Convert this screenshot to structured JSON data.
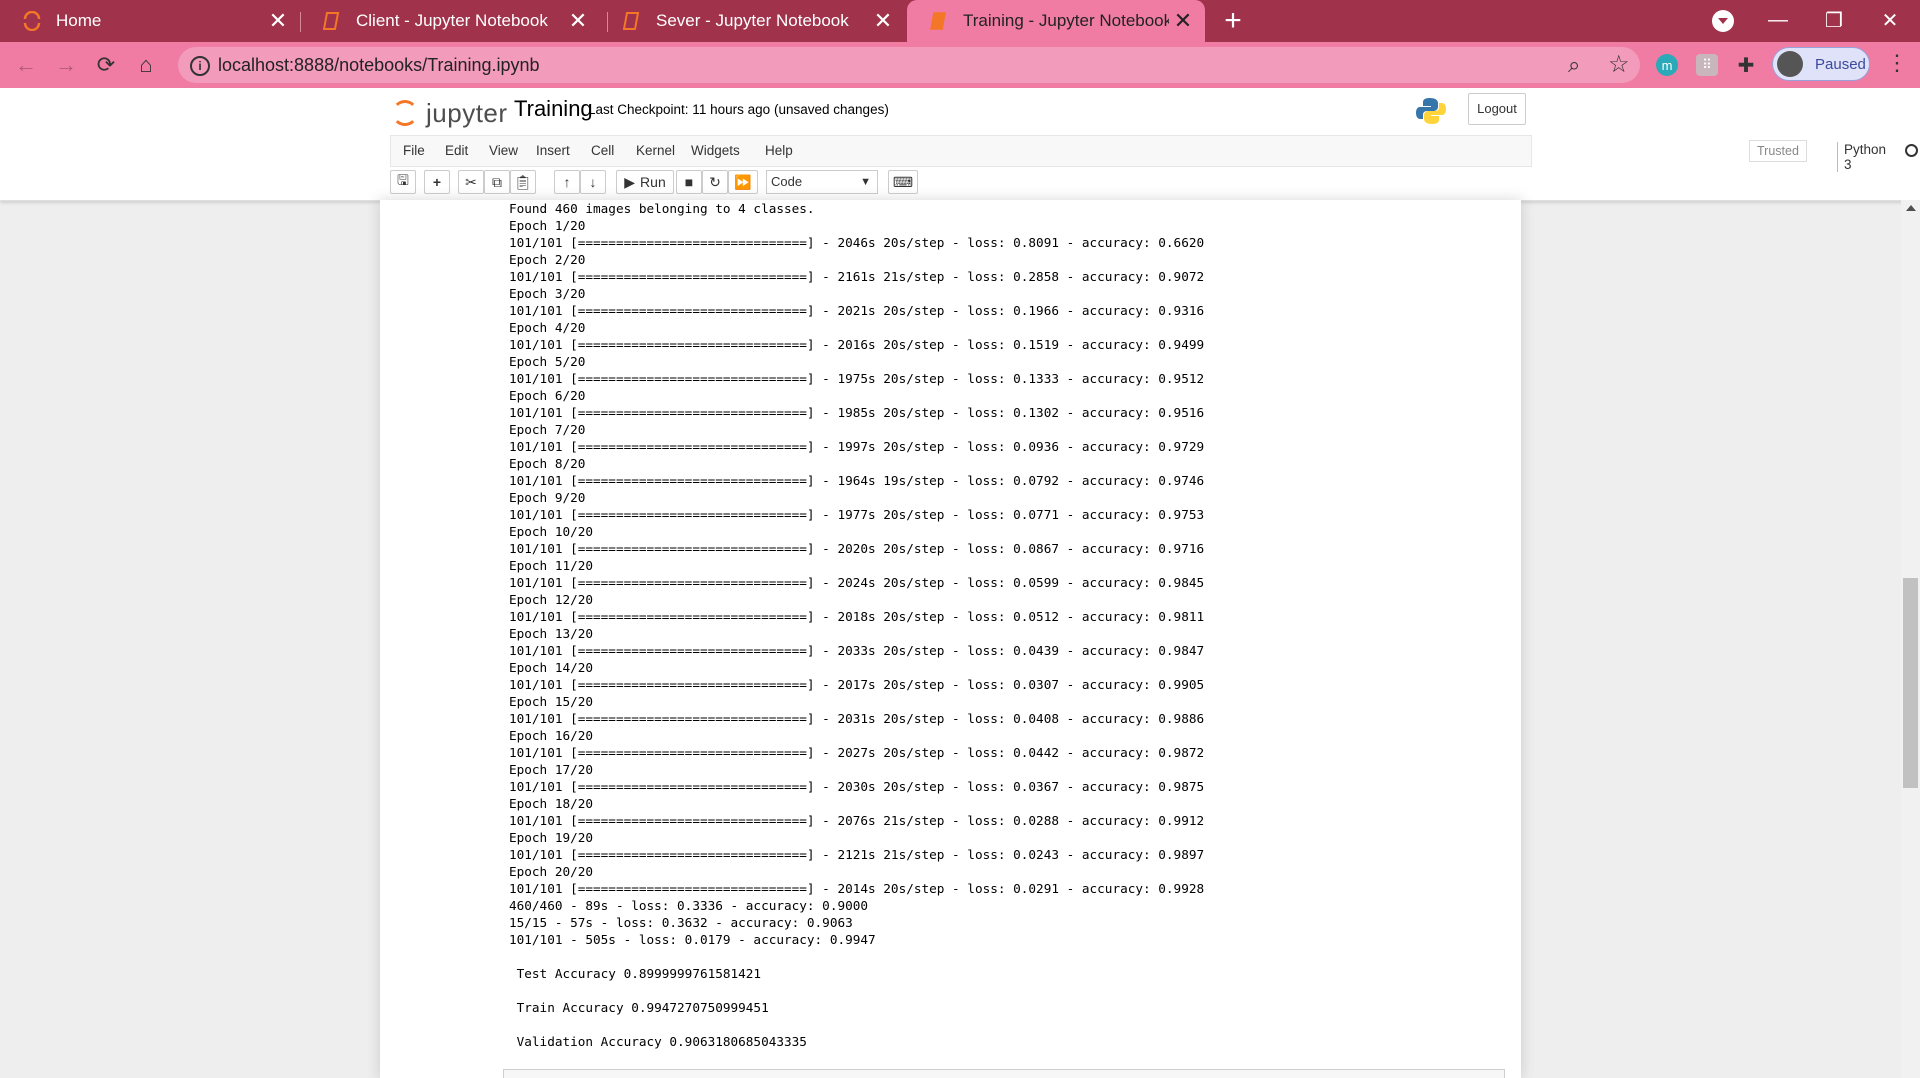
{
  "browser": {
    "tabs": [
      {
        "title": "Home",
        "icon": "jupyter-icon",
        "active": false
      },
      {
        "title": "Client - Jupyter Notebook",
        "icon": "notebook-icon",
        "active": false
      },
      {
        "title": "Sever - Jupyter Notebook",
        "icon": "notebook-icon",
        "active": false
      },
      {
        "title": "Training - Jupyter Notebook",
        "icon": "notebook-icon",
        "active": true
      }
    ],
    "url": "localhost:8888/notebooks/Training.ipynb",
    "profile_status": "Paused",
    "extensions": [
      {
        "icon": "m-extension-icon",
        "label": "m",
        "color": "#2aa9b8"
      },
      {
        "icon": "grid-extension-icon",
        "label": "⠿",
        "color": "#c9b6bd"
      },
      {
        "icon": "puzzle-icon",
        "label": "",
        "color": ""
      }
    ],
    "colors": {
      "frame": "#a0324b",
      "toolbar": "#f07ca4",
      "omnibox": "#f39bba"
    }
  },
  "jupyter": {
    "logo_text": "jupyter",
    "notebook_name": "Training",
    "checkpoint": "Last Checkpoint: 11 hours ago",
    "status": "(unsaved changes)",
    "logout_label": "Logout",
    "menu": [
      "File",
      "Edit",
      "View",
      "Insert",
      "Cell",
      "Kernel",
      "Widgets",
      "Help"
    ],
    "trusted_label": "Trusted",
    "kernel_name": "Python 3",
    "run_label": "Run",
    "cell_type": "Code"
  },
  "output_lines": [
    "Found 460 images belonging to 4 classes.",
    "Epoch 1/20",
    "101/101 [==============================] - 2046s 20s/step - loss: 0.8091 - accuracy: 0.6620",
    "Epoch 2/20",
    "101/101 [==============================] - 2161s 21s/step - loss: 0.2858 - accuracy: 0.9072",
    "Epoch 3/20",
    "101/101 [==============================] - 2021s 20s/step - loss: 0.1966 - accuracy: 0.9316",
    "Epoch 4/20",
    "101/101 [==============================] - 2016s 20s/step - loss: 0.1519 - accuracy: 0.9499",
    "Epoch 5/20",
    "101/101 [==============================] - 1975s 20s/step - loss: 0.1333 - accuracy: 0.9512",
    "Epoch 6/20",
    "101/101 [==============================] - 1985s 20s/step - loss: 0.1302 - accuracy: 0.9516",
    "Epoch 7/20",
    "101/101 [==============================] - 1997s 20s/step - loss: 0.0936 - accuracy: 0.9729",
    "Epoch 8/20",
    "101/101 [==============================] - 1964s 19s/step - loss: 0.0792 - accuracy: 0.9746",
    "Epoch 9/20",
    "101/101 [==============================] - 1977s 20s/step - loss: 0.0771 - accuracy: 0.9753",
    "Epoch 10/20",
    "101/101 [==============================] - 2020s 20s/step - loss: 0.0867 - accuracy: 0.9716",
    "Epoch 11/20",
    "101/101 [==============================] - 2024s 20s/step - loss: 0.0599 - accuracy: 0.9845",
    "Epoch 12/20",
    "101/101 [==============================] - 2018s 20s/step - loss: 0.0512 - accuracy: 0.9811",
    "Epoch 13/20",
    "101/101 [==============================] - 2033s 20s/step - loss: 0.0439 - accuracy: 0.9847",
    "Epoch 14/20",
    "101/101 [==============================] - 2017s 20s/step - loss: 0.0307 - accuracy: 0.9905",
    "Epoch 15/20",
    "101/101 [==============================] - 2031s 20s/step - loss: 0.0408 - accuracy: 0.9886",
    "Epoch 16/20",
    "101/101 [==============================] - 2027s 20s/step - loss: 0.0442 - accuracy: 0.9872",
    "Epoch 17/20",
    "101/101 [==============================] - 2030s 20s/step - loss: 0.0367 - accuracy: 0.9875",
    "Epoch 18/20",
    "101/101 [==============================] - 2076s 21s/step - loss: 0.0288 - accuracy: 0.9912",
    "Epoch 19/20",
    "101/101 [==============================] - 2121s 21s/step - loss: 0.0243 - accuracy: 0.9897",
    "Epoch 20/20",
    "101/101 [==============================] - 2014s 20s/step - loss: 0.0291 - accuracy: 0.9928",
    "460/460 - 89s - loss: 0.3336 - accuracy: 0.9000",
    "15/15 - 57s - loss: 0.3632 - accuracy: 0.9063",
    "101/101 - 505s - loss: 0.0179 - accuracy: 0.9947",
    "",
    " Test Accuracy 0.8999999761581421",
    "",
    " Train Accuracy 0.9947270750999451",
    "",
    " Validation Accuracy 0.9063180685043335"
  ]
}
